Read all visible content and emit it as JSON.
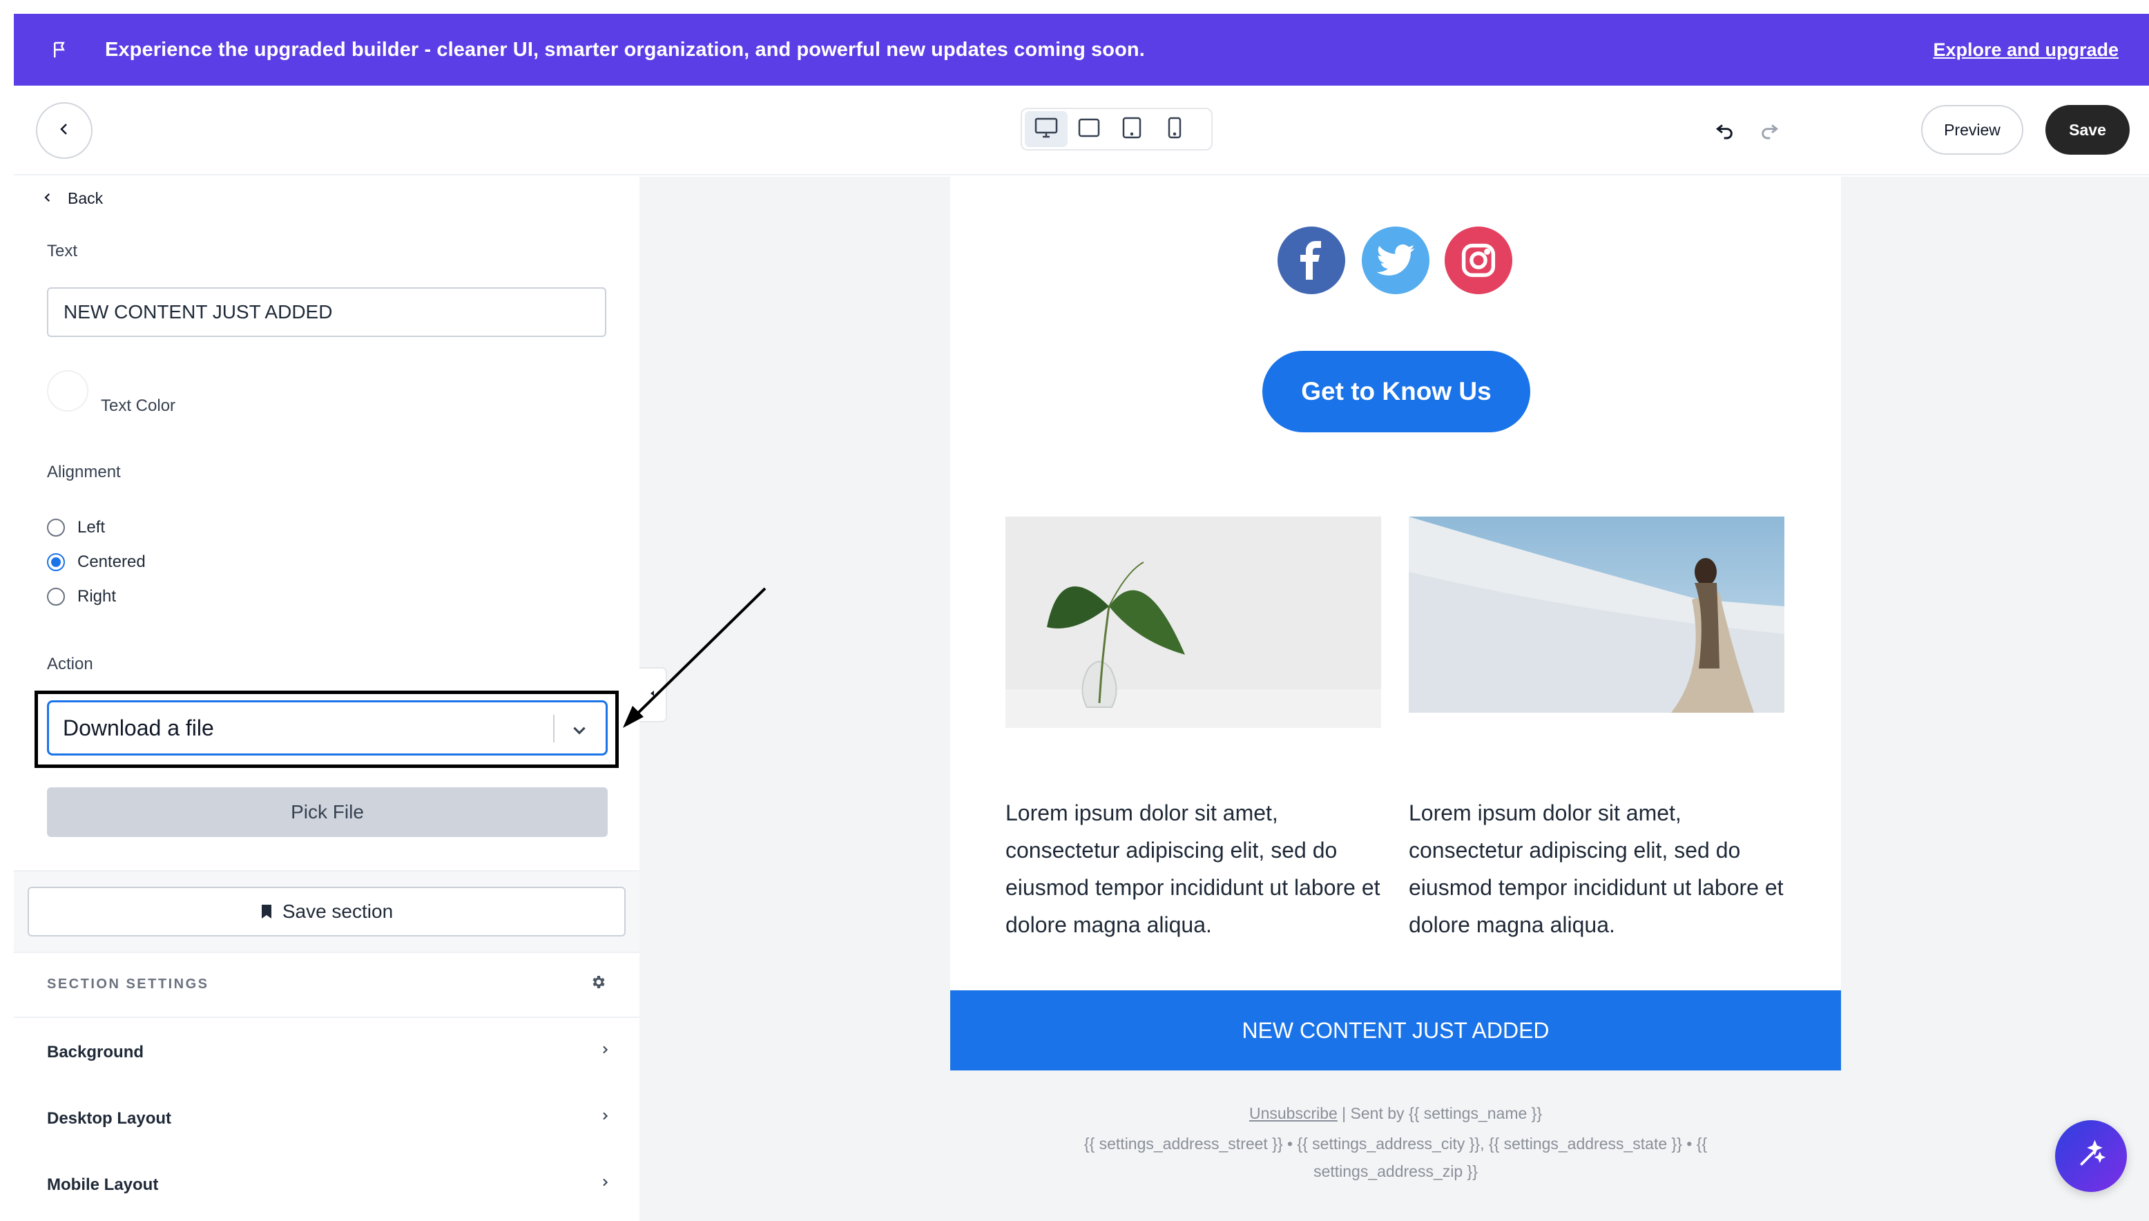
{
  "banner": {
    "message": "Experience the upgraded builder - cleaner UI, smarter organization, and powerful new updates coming soon.",
    "cta": "Explore and upgrade",
    "icon": "flag-icon"
  },
  "topbar": {
    "back_icon": "chevron-left-icon",
    "devices": [
      "desktop-icon",
      "laptop-icon",
      "tablet-icon",
      "mobile-icon"
    ],
    "active_device": "desktop",
    "preview_label": "Preview",
    "save_label": "Save"
  },
  "panel": {
    "back_label": "Back",
    "text_label": "Text",
    "text_value": "NEW CONTENT JUST ADDED",
    "text_color_label": "Text Color",
    "alignment_label": "Alignment",
    "alignment_options": [
      "Left",
      "Centered",
      "Right"
    ],
    "alignment_selected": "Centered",
    "action_label": "Action",
    "action_value": "Download a file",
    "pick_file_label": "Pick File",
    "save_section_label": "Save section",
    "section_settings_label": "SECTION SETTINGS",
    "nav": [
      "Background",
      "Desktop Layout",
      "Mobile Layout"
    ]
  },
  "email": {
    "cta_label": "Get to Know Us",
    "paragraph_left": "Lorem ipsum dolor sit amet, consectetur adipiscing elit, sed do eiusmod tempor incididunt ut labore et dolore magna aliqua.",
    "paragraph_right": "Lorem ipsum dolor sit amet, consectetur adipiscing elit, sed do eiusmod tempor incididunt ut labore et dolore magna aliqua.",
    "banner_text": "NEW CONTENT JUST ADDED",
    "footer_unsubscribe": "Unsubscribe",
    "footer_sent_by": " | Sent by {{ settings_name }}",
    "footer_address_1": "{{ settings_address_street }} • {{ settings_address_city }}, {{ settings_address_state }} • {{",
    "footer_address_2": "settings_address_zip }}"
  },
  "colors": {
    "banner": "#5b3ee6",
    "primary": "#1a73e8",
    "facebook": "#4267b2",
    "twitter": "#55acee",
    "instagram": "#e4405f"
  }
}
